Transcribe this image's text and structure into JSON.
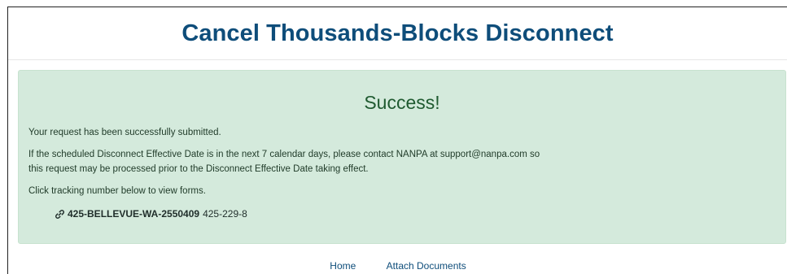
{
  "header": {
    "title": "Cancel Thousands-Blocks Disconnect"
  },
  "alert": {
    "title": "Success!",
    "line1": "Your request has been successfully submitted.",
    "line2a": "If the scheduled Disconnect Effective Date is in the next 7 calendar days, please contact NANPA at support@nanpa.com so",
    "line2b": "this request may be processed prior to the Disconnect Effective Date taking effect.",
    "line3": "Click tracking number below to view forms.",
    "tracking": {
      "number": "425-BELLEVUE-WA-2550409",
      "suffix": "425-229-8",
      "icon": "link-icon"
    }
  },
  "footer": {
    "links": [
      {
        "label": "Home"
      },
      {
        "label": "Attach Documents"
      }
    ]
  },
  "colors": {
    "title": "#0e4d7a",
    "alert_bg": "#d4eadc",
    "alert_title": "#1f5a30",
    "link": "#0e4d7a"
  }
}
